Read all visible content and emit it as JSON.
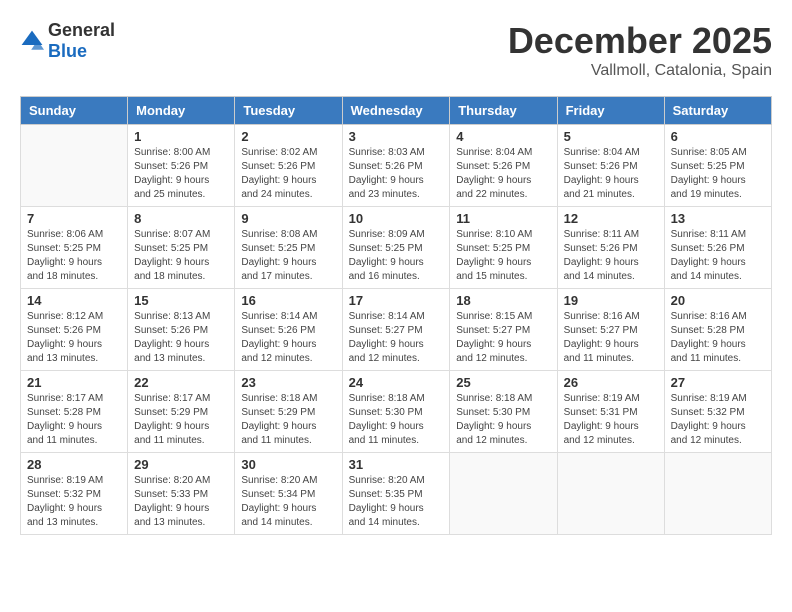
{
  "header": {
    "logo_general": "General",
    "logo_blue": "Blue",
    "month": "December 2025",
    "location": "Vallmoll, Catalonia, Spain"
  },
  "days_of_week": [
    "Sunday",
    "Monday",
    "Tuesday",
    "Wednesday",
    "Thursday",
    "Friday",
    "Saturday"
  ],
  "weeks": [
    [
      {
        "day": "",
        "info": ""
      },
      {
        "day": "1",
        "info": "Sunrise: 8:00 AM\nSunset: 5:26 PM\nDaylight: 9 hours\nand 25 minutes."
      },
      {
        "day": "2",
        "info": "Sunrise: 8:02 AM\nSunset: 5:26 PM\nDaylight: 9 hours\nand 24 minutes."
      },
      {
        "day": "3",
        "info": "Sunrise: 8:03 AM\nSunset: 5:26 PM\nDaylight: 9 hours\nand 23 minutes."
      },
      {
        "day": "4",
        "info": "Sunrise: 8:04 AM\nSunset: 5:26 PM\nDaylight: 9 hours\nand 22 minutes."
      },
      {
        "day": "5",
        "info": "Sunrise: 8:04 AM\nSunset: 5:26 PM\nDaylight: 9 hours\nand 21 minutes."
      },
      {
        "day": "6",
        "info": "Sunrise: 8:05 AM\nSunset: 5:25 PM\nDaylight: 9 hours\nand 19 minutes."
      }
    ],
    [
      {
        "day": "7",
        "info": "Sunrise: 8:06 AM\nSunset: 5:25 PM\nDaylight: 9 hours\nand 18 minutes."
      },
      {
        "day": "8",
        "info": "Sunrise: 8:07 AM\nSunset: 5:25 PM\nDaylight: 9 hours\nand 18 minutes."
      },
      {
        "day": "9",
        "info": "Sunrise: 8:08 AM\nSunset: 5:25 PM\nDaylight: 9 hours\nand 17 minutes."
      },
      {
        "day": "10",
        "info": "Sunrise: 8:09 AM\nSunset: 5:25 PM\nDaylight: 9 hours\nand 16 minutes."
      },
      {
        "day": "11",
        "info": "Sunrise: 8:10 AM\nSunset: 5:25 PM\nDaylight: 9 hours\nand 15 minutes."
      },
      {
        "day": "12",
        "info": "Sunrise: 8:11 AM\nSunset: 5:26 PM\nDaylight: 9 hours\nand 14 minutes."
      },
      {
        "day": "13",
        "info": "Sunrise: 8:11 AM\nSunset: 5:26 PM\nDaylight: 9 hours\nand 14 minutes."
      }
    ],
    [
      {
        "day": "14",
        "info": "Sunrise: 8:12 AM\nSunset: 5:26 PM\nDaylight: 9 hours\nand 13 minutes."
      },
      {
        "day": "15",
        "info": "Sunrise: 8:13 AM\nSunset: 5:26 PM\nDaylight: 9 hours\nand 13 minutes."
      },
      {
        "day": "16",
        "info": "Sunrise: 8:14 AM\nSunset: 5:26 PM\nDaylight: 9 hours\nand 12 minutes."
      },
      {
        "day": "17",
        "info": "Sunrise: 8:14 AM\nSunset: 5:27 PM\nDaylight: 9 hours\nand 12 minutes."
      },
      {
        "day": "18",
        "info": "Sunrise: 8:15 AM\nSunset: 5:27 PM\nDaylight: 9 hours\nand 12 minutes."
      },
      {
        "day": "19",
        "info": "Sunrise: 8:16 AM\nSunset: 5:27 PM\nDaylight: 9 hours\nand 11 minutes."
      },
      {
        "day": "20",
        "info": "Sunrise: 8:16 AM\nSunset: 5:28 PM\nDaylight: 9 hours\nand 11 minutes."
      }
    ],
    [
      {
        "day": "21",
        "info": "Sunrise: 8:17 AM\nSunset: 5:28 PM\nDaylight: 9 hours\nand 11 minutes."
      },
      {
        "day": "22",
        "info": "Sunrise: 8:17 AM\nSunset: 5:29 PM\nDaylight: 9 hours\nand 11 minutes."
      },
      {
        "day": "23",
        "info": "Sunrise: 8:18 AM\nSunset: 5:29 PM\nDaylight: 9 hours\nand 11 minutes."
      },
      {
        "day": "24",
        "info": "Sunrise: 8:18 AM\nSunset: 5:30 PM\nDaylight: 9 hours\nand 11 minutes."
      },
      {
        "day": "25",
        "info": "Sunrise: 8:18 AM\nSunset: 5:30 PM\nDaylight: 9 hours\nand 12 minutes."
      },
      {
        "day": "26",
        "info": "Sunrise: 8:19 AM\nSunset: 5:31 PM\nDaylight: 9 hours\nand 12 minutes."
      },
      {
        "day": "27",
        "info": "Sunrise: 8:19 AM\nSunset: 5:32 PM\nDaylight: 9 hours\nand 12 minutes."
      }
    ],
    [
      {
        "day": "28",
        "info": "Sunrise: 8:19 AM\nSunset: 5:32 PM\nDaylight: 9 hours\nand 13 minutes."
      },
      {
        "day": "29",
        "info": "Sunrise: 8:20 AM\nSunset: 5:33 PM\nDaylight: 9 hours\nand 13 minutes."
      },
      {
        "day": "30",
        "info": "Sunrise: 8:20 AM\nSunset: 5:34 PM\nDaylight: 9 hours\nand 14 minutes."
      },
      {
        "day": "31",
        "info": "Sunrise: 8:20 AM\nSunset: 5:35 PM\nDaylight: 9 hours\nand 14 minutes."
      },
      {
        "day": "",
        "info": ""
      },
      {
        "day": "",
        "info": ""
      },
      {
        "day": "",
        "info": ""
      }
    ]
  ]
}
